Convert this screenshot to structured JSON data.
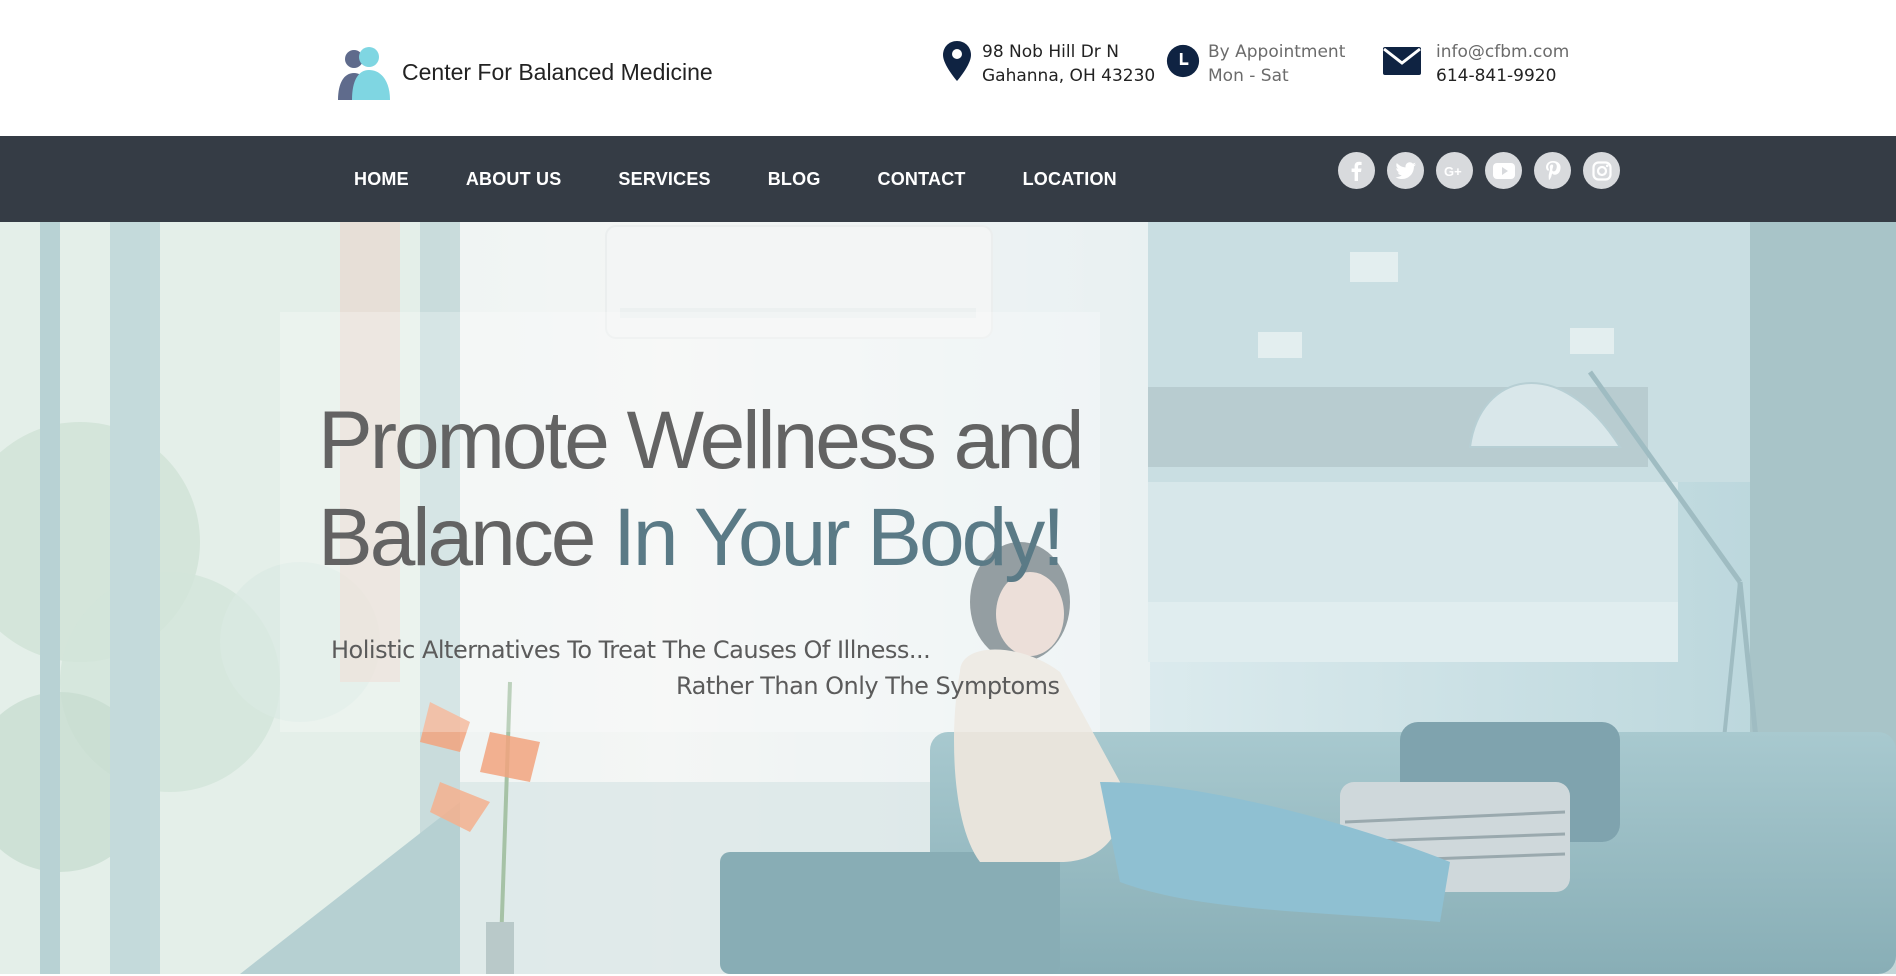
{
  "header": {
    "logo_text": "Center For Balanced Medicine",
    "address": {
      "icon": "map-pin-icon",
      "line1": "98 Nob Hill Dr N",
      "line2": "Gahanna, OH 43230"
    },
    "hours": {
      "icon": "clock-icon",
      "line1": "By Appointment",
      "line2": "Mon - Sat"
    },
    "contact": {
      "icon": "envelope-icon",
      "email": "info@cfbm.com",
      "phone": "614-841-9920"
    }
  },
  "nav": {
    "items": [
      {
        "label": "HOME"
      },
      {
        "label": "ABOUT US"
      },
      {
        "label": "SERVICES"
      },
      {
        "label": "BLOG"
      },
      {
        "label": "CONTACT"
      },
      {
        "label": "LOCATION"
      }
    ],
    "social": [
      "facebook-icon",
      "twitter-icon",
      "google-plus-icon",
      "youtube-icon",
      "pinterest-icon",
      "instagram-icon"
    ]
  },
  "hero": {
    "headline_part1": "Promote Wellness and",
    "headline_part2": "Balance",
    "headline_part3": "In Your Body!",
    "subline1": "Holistic Alternatives To Treat The Causes Of Illness...",
    "subline2": "Rather Than Only The Symptoms"
  },
  "colors": {
    "navbar": "#353c45",
    "icon_dark": "#0f2342",
    "logo_light": "#7fd6e2",
    "logo_dark": "#5f6b8c",
    "headline": "#636363",
    "headline_accent": "#5a7a86"
  }
}
